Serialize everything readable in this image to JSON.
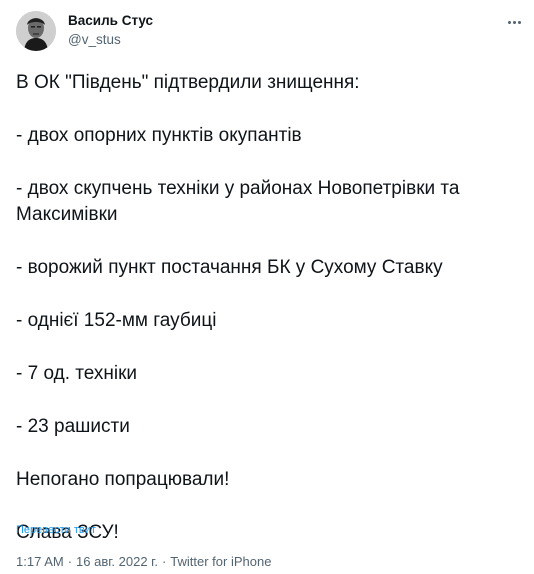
{
  "author": {
    "name": "Василь Стус",
    "handle": "@v_stus",
    "avatar_icon": "portrait-photo"
  },
  "more_icon": "three-dots-icon",
  "tweet": {
    "lines": [
      "В ОК \"Південь\" підтвердили знищення:",
      "- двох опорних пунктів окупантів",
      "- двох скупчень техніки у районах Новопетрівки та Максимівки",
      "- ворожий пункт постачання БК у Сухому Ставку",
      "- однієї 152-мм гаубиці",
      "- 7 од. техніки",
      "- 23 рашисти",
      "Непогано попрацювали!",
      "Слава ЗСУ!"
    ],
    "flag_icon": "ukraine-flag-emoji"
  },
  "translate_label": "Перевести твит",
  "meta": {
    "time": "1:17 AM",
    "separator": "·",
    "date": "16 авг. 2022 г.",
    "source": "Twitter for iPhone"
  },
  "colors": {
    "text": "#0f1419",
    "secondary": "#536471",
    "link": "#1d9bf0",
    "flag_blue": "#2a6fd6",
    "flag_yellow": "#f7cc2c"
  }
}
